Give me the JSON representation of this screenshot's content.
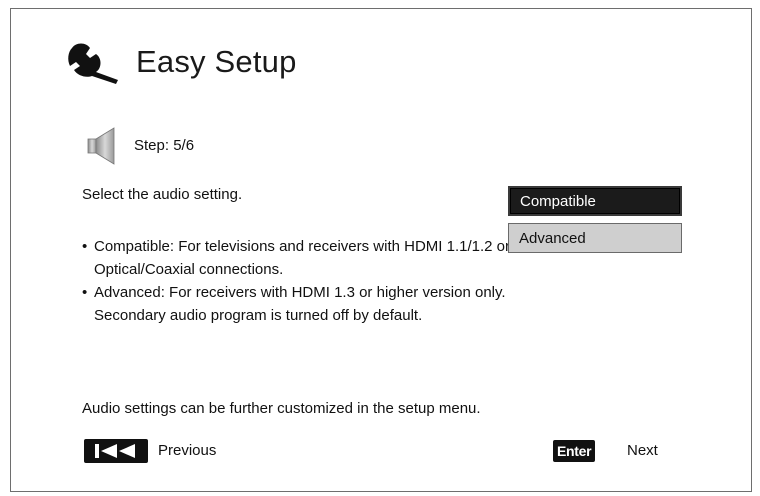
{
  "header": {
    "title": "Easy Setup",
    "icon": "wrench-icon"
  },
  "step": {
    "label": "Step: 5/6",
    "icon": "speaker-icon"
  },
  "prompt": "Select the audio setting.",
  "bullets": [
    {
      "marker": "•",
      "text": "Compatible: For televisions and receivers with HDMI 1.1/1.2 or Optical/Coaxial connections."
    },
    {
      "marker": "•",
      "text": "Advanced: For receivers with HDMI 1.3 or higher version only. Secondary audio program is turned off by default."
    }
  ],
  "options": [
    {
      "label": "Compatible",
      "selected": true
    },
    {
      "label": "Advanced",
      "selected": false
    }
  ],
  "footnote": "Audio settings can be further customized in the setup menu.",
  "nav": {
    "previous_icon": "skip-previous-icon",
    "previous_label": "Previous",
    "enter_key": "Enter",
    "next_label": "Next"
  },
  "colors": {
    "selected_bg": "#1b1b1b",
    "option_bg": "#cfcfcf",
    "frame": "#6e6e6e"
  }
}
